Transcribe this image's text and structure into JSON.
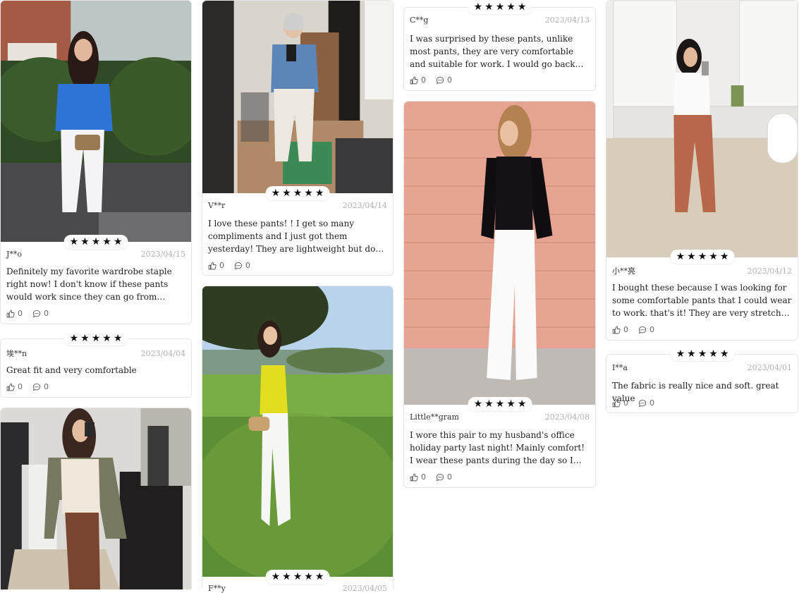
{
  "colors": {
    "star": "#111111",
    "date": "#b2b2b2",
    "border": "#e6e6e6"
  },
  "rating_star": "★",
  "icons": {
    "like": "thumbs-up-icon",
    "comment": "comment-icon",
    "rating": "star-icon"
  },
  "reviews": {
    "r1": {
      "author": "J**o",
      "date": "2023/04/15",
      "text": "Definitely my favorite wardrobe staple right now! I don't know if these pants would work since they can go from elegant to jogging, bu...",
      "likes": "0",
      "comments": "0"
    },
    "r2": {
      "author": "埃**n",
      "date": "2023/04/04",
      "text": "Great fit and very comfortable",
      "likes": "0",
      "comments": "0"
    },
    "r4": {
      "author": "V**r",
      "date": "2023/04/14",
      "text": "I love these pants! ! I get so many compliments and I just got them yesterday! They are lightweight but don't look or feel ...",
      "likes": "0",
      "comments": "0"
    },
    "r5": {
      "author": "F**y",
      "date": "2023/04/05"
    },
    "r6": {
      "author": "C**g",
      "date": "2023/04/13",
      "text": "I was surprised by these pants, unlike most pants, they are very comfortable and suitable for work. I would go back and buy another ...",
      "likes": "0",
      "comments": "0"
    },
    "r7": {
      "author": "Little**gram",
      "date": "2023/04/08",
      "text": "I wore this pair to my husband's office holiday party last night! Mainly comfort! I wear these pants during the day so I can dre...",
      "likes": "0",
      "comments": "0"
    },
    "r8": {
      "author": "小**亮",
      "date": "2023/04/12",
      "text": "I bought these because I was looking for some comfortable pants that I could wear to work. that's it! They are very stretchy and ...",
      "likes": "0",
      "comments": "0"
    },
    "r9": {
      "author": "I**a",
      "date": "2023/04/01",
      "text": "The fabric is really nice and soft. great value",
      "likes": "0",
      "comments": "0"
    }
  }
}
